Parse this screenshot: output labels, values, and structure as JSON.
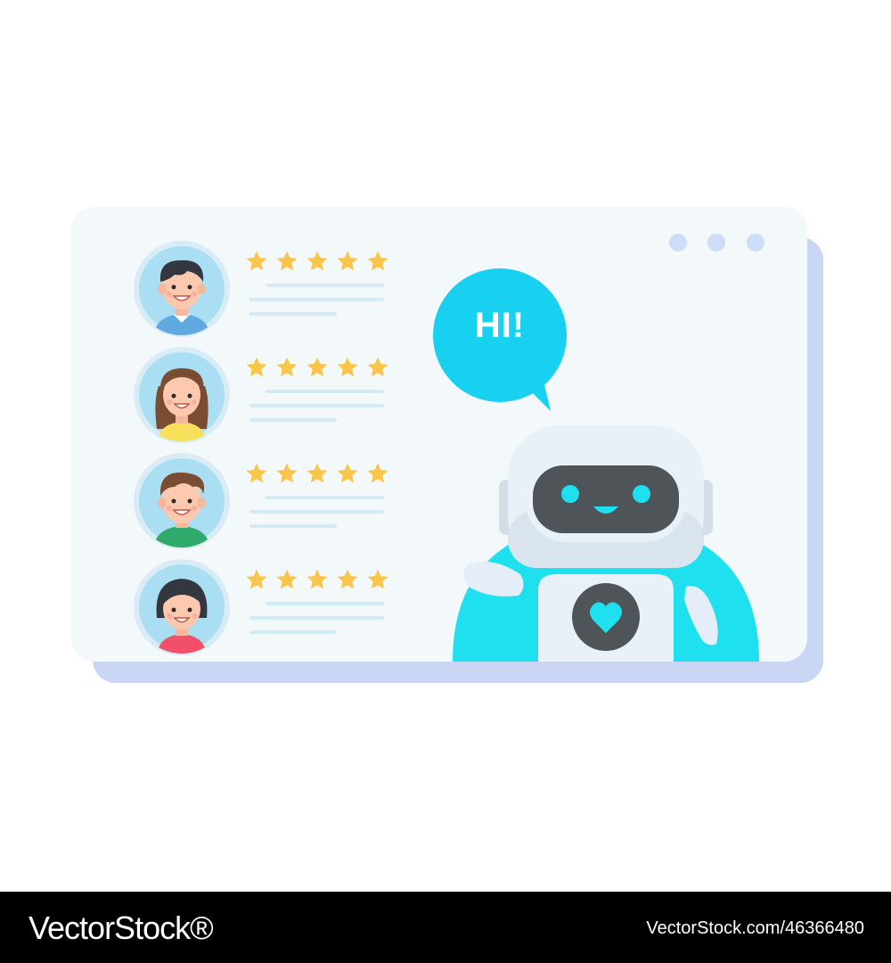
{
  "window": {
    "dots": 3,
    "colors": {
      "card": "#f3f8fb",
      "shadow": "#c9d6f4",
      "dots": "#cddcf7"
    }
  },
  "reviews": [
    {
      "avatar": "man-short-hair-avatar",
      "rating": 5,
      "max": 5
    },
    {
      "avatar": "woman-long-hair-avatar",
      "rating": 5,
      "max": 5
    },
    {
      "avatar": "man-brown-hair-avatar",
      "rating": 5,
      "max": 5
    },
    {
      "avatar": "woman-bob-hair-avatar",
      "rating": 5,
      "max": 5
    }
  ],
  "speech_bubble": {
    "text": "HI!",
    "color": "#18d0ef"
  },
  "robot": {
    "icon": "robot-icon",
    "chest_icon": "heart-icon",
    "accent": "#1ee0ee",
    "screen": "#4f5459"
  },
  "star_color": "#f9c54b",
  "footer": {
    "brand": "VectorStock®",
    "id": "VectorStock.com/46366480"
  }
}
